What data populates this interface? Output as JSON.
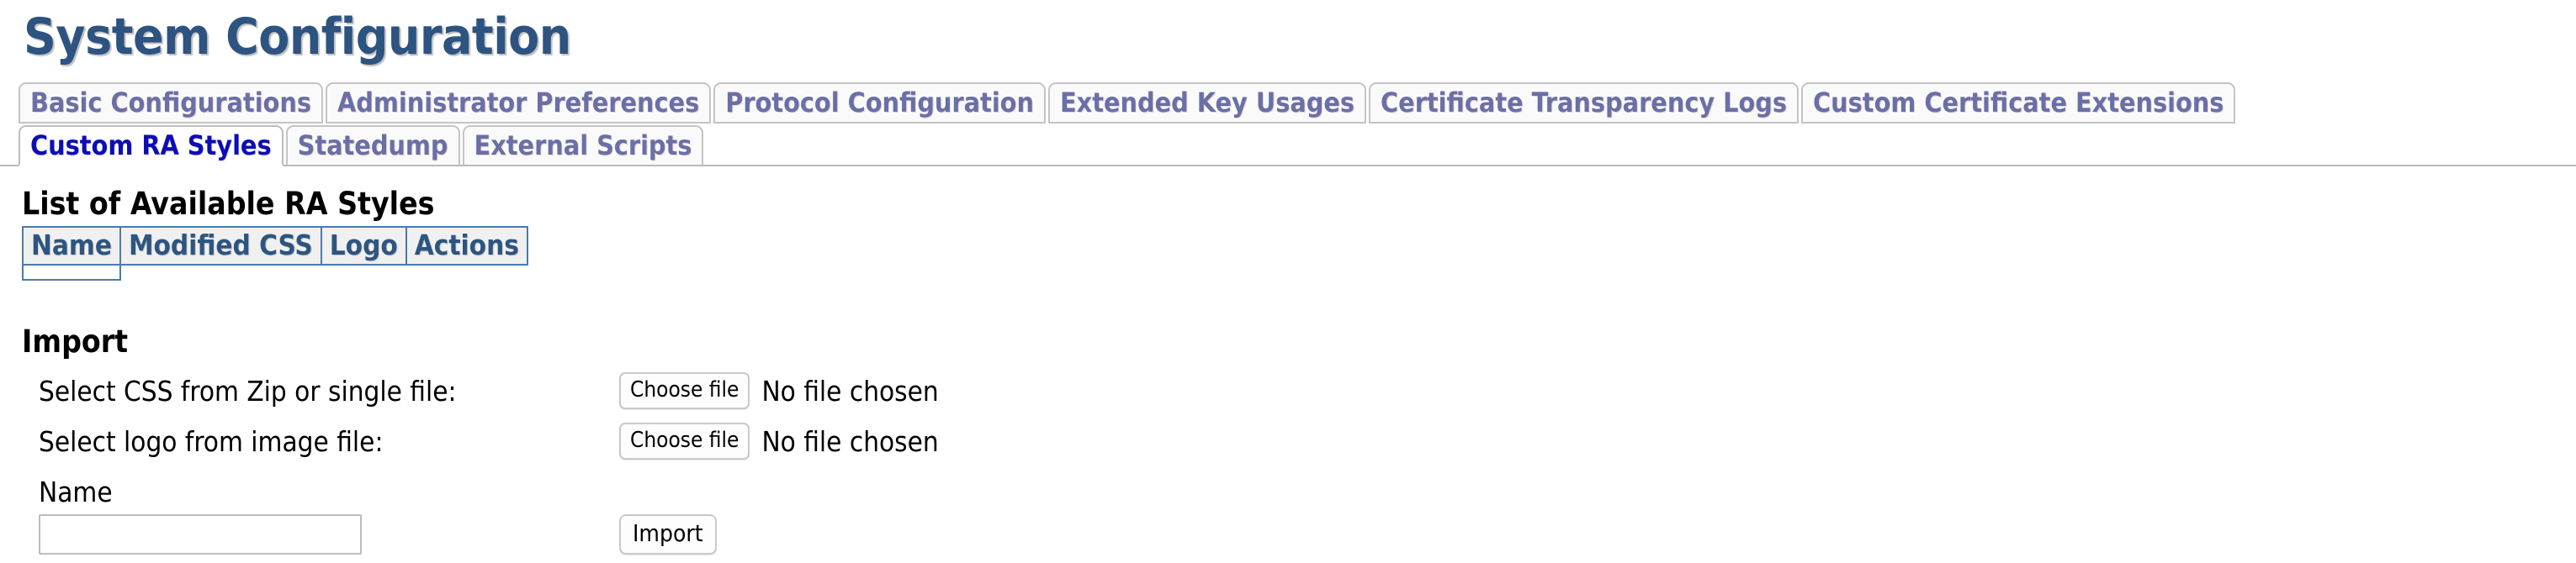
{
  "page": {
    "title": "System Configuration"
  },
  "tabs": {
    "row1": [
      {
        "label": "Basic Configurations",
        "active": false
      },
      {
        "label": "Administrator Preferences",
        "active": false
      },
      {
        "label": "Protocol Configuration",
        "active": false
      },
      {
        "label": "Extended Key Usages",
        "active": false
      },
      {
        "label": "Certificate Transparency Logs",
        "active": false
      },
      {
        "label": "Custom Certificate Extensions",
        "active": false
      }
    ],
    "row2": [
      {
        "label": "Custom RA Styles",
        "active": true
      },
      {
        "label": "Statedump",
        "active": false
      },
      {
        "label": "External Scripts",
        "active": false
      }
    ]
  },
  "styles_section": {
    "heading": "List of Available RA Styles",
    "columns": [
      "Name",
      "Modified CSS",
      "Logo",
      "Actions"
    ],
    "rows": []
  },
  "import_section": {
    "heading": "Import",
    "css_row": {
      "label": "Select CSS from Zip or single file:",
      "button_label": "Choose file",
      "status_text": "No file chosen"
    },
    "logo_row": {
      "label": "Select logo from image file:",
      "button_label": "Choose file",
      "status_text": "No file chosen"
    },
    "name_label": "Name",
    "name_value": "",
    "name_placeholder": "",
    "submit_label": "Import"
  },
  "colors": {
    "title": "#2d5380",
    "tab_inactive_text": "#6a6fa6",
    "tab_active_text": "#0d0db5",
    "table_header_text": "#2d5580",
    "table_border": "#4a7bab",
    "table_header_bg": "#f0f0f0",
    "tab_border": "#c4c4c4",
    "content_border": "#b9b9b9"
  }
}
